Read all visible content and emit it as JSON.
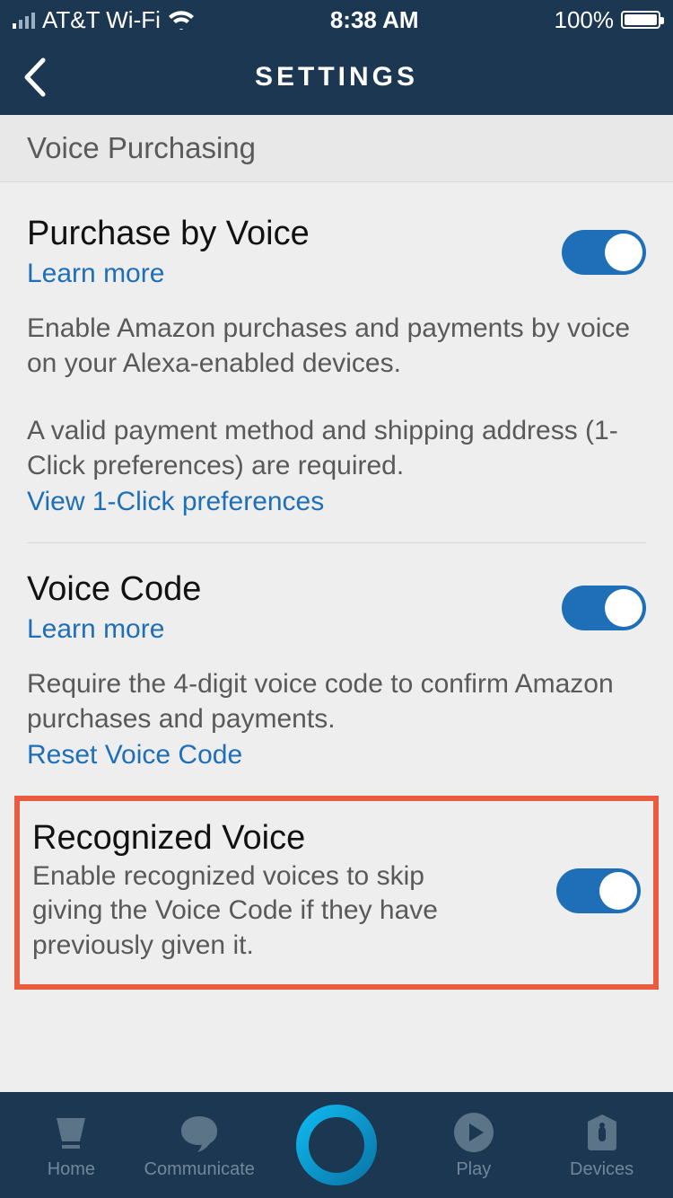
{
  "status": {
    "carrier": "AT&T Wi-Fi",
    "time": "8:38 AM",
    "battery_pct": "100%"
  },
  "nav": {
    "title": "SETTINGS"
  },
  "section_header": "Voice Purchasing",
  "purchase": {
    "title": "Purchase by Voice",
    "learn_more": "Learn more",
    "desc": "Enable Amazon purchases and payments by voice on your Alexa-enabled devices.",
    "req": "A valid payment method and shipping address (1-Click preferences) are required.",
    "prefs_link": "View 1-Click preferences",
    "toggle_on": true
  },
  "voice_code": {
    "title": "Voice Code",
    "learn_more": "Learn more",
    "desc": "Require the 4-digit voice code to confirm Amazon purchases and payments.",
    "reset_link": "Reset Voice Code",
    "toggle_on": true
  },
  "recognized": {
    "title": "Recognized Voice",
    "desc": "Enable recognized voices to skip giving the Voice Code if they have previously given it.",
    "toggle_on": true
  },
  "tabs": {
    "home": "Home",
    "communicate": "Communicate",
    "play": "Play",
    "devices": "Devices"
  }
}
